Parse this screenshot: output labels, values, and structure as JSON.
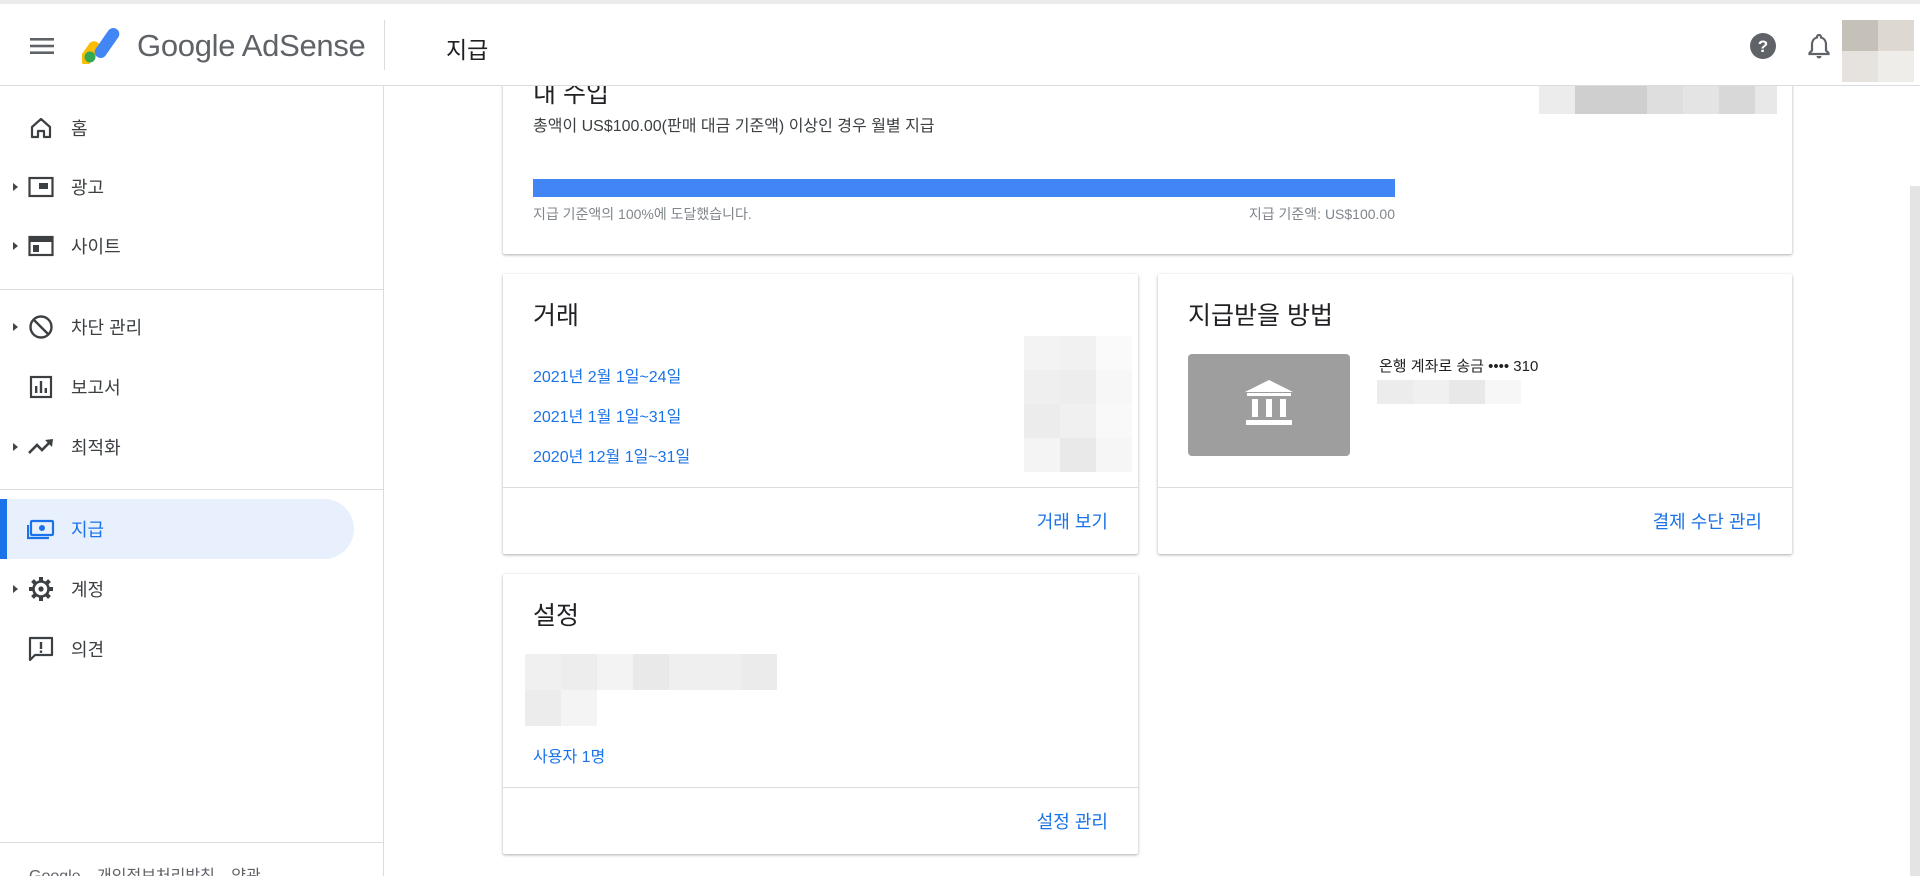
{
  "app": {
    "brand": "Google AdSense",
    "page_title": "지급"
  },
  "sidebar": {
    "items": [
      {
        "label": "홈",
        "icon": "home-icon",
        "expandable": false
      },
      {
        "label": "광고",
        "icon": "ads-icon",
        "expandable": true
      },
      {
        "label": "사이트",
        "icon": "sites-icon",
        "expandable": true
      },
      {
        "label": "차단 관리",
        "icon": "block-icon",
        "expandable": true
      },
      {
        "label": "보고서",
        "icon": "reports-icon",
        "expandable": false
      },
      {
        "label": "최적화",
        "icon": "trending-up-icon",
        "expandable": true
      },
      {
        "label": "지급",
        "icon": "payments-icon",
        "expandable": false,
        "active": true
      },
      {
        "label": "계정",
        "icon": "gear-icon",
        "expandable": true
      },
      {
        "label": "의견",
        "icon": "feedback-icon",
        "expandable": false
      }
    ],
    "footer": [
      "Google",
      "개인정보처리방침",
      "약관"
    ]
  },
  "earnings": {
    "title": "내 수입",
    "subtitle": "총액이 US$100.00(판매 대금 기준액) 이상인 경우 월별 지급",
    "progress": 1.0,
    "progress_label": "지급 기준액의 100%에 도달했습니다.",
    "threshold_label": "지급 기준액: US$100.00"
  },
  "transactions": {
    "title": "거래",
    "periods": [
      "2021년 2월 1일~24일",
      "2021년 1월 1일~31일",
      "2020년 12월 1일~31일"
    ],
    "action": "거래 보기"
  },
  "payment_method": {
    "title": "지급받을 방법",
    "method": "온행 계좌로 송금 •••• 310",
    "action": "결제 수단 관리"
  },
  "settings": {
    "title": "설정",
    "users_link": "사용자 1명",
    "action": "설정 관리"
  },
  "colors": {
    "accent": "#1a73e8",
    "progress": "#4285f4",
    "active_bg": "#e8f0fe"
  }
}
